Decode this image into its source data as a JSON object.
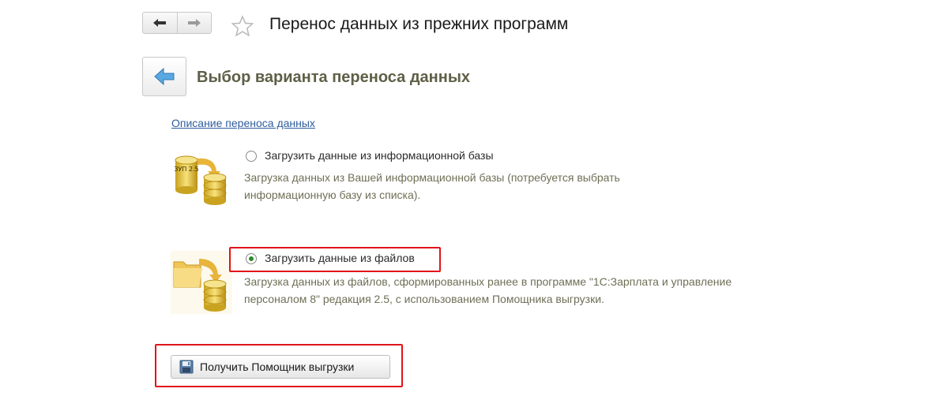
{
  "window": {
    "title": "Перенос данных из прежних программ"
  },
  "nav": {
    "back_icon": "arrow-left-icon",
    "forward_icon": "arrow-right-icon",
    "favorite_icon": "star-icon"
  },
  "page": {
    "heading": "Выбор варианта переноса данных",
    "description_link": "Описание переноса данных"
  },
  "options": [
    {
      "label": "Загрузить данные из информационной базы",
      "description_line1": "Загрузка данных из Вашей информационной базы (потребуется выбрать",
      "description_line2": "информационную базу из списка).",
      "selected": false,
      "icon": "database-transfer-icon",
      "icon_caption": "ЗУП 2.5"
    },
    {
      "label": "Загрузить данные из файлов",
      "description_line1": "Загрузка данных из файлов, сформированных ранее в программе \"1С:Зарплата и управление",
      "description_line2": "персоналом 8\" редакция 2.5, с использованием Помощника выгрузки.",
      "selected": true,
      "icon": "folder-to-database-icon"
    }
  ],
  "action": {
    "label": "Получить Помощник выгрузки",
    "icon": "save-disk-icon"
  },
  "colors": {
    "highlight": "#e2131a",
    "heading": "#5f5f47",
    "link": "#2f5d9c",
    "radio_selected": "#2d8a2d"
  }
}
